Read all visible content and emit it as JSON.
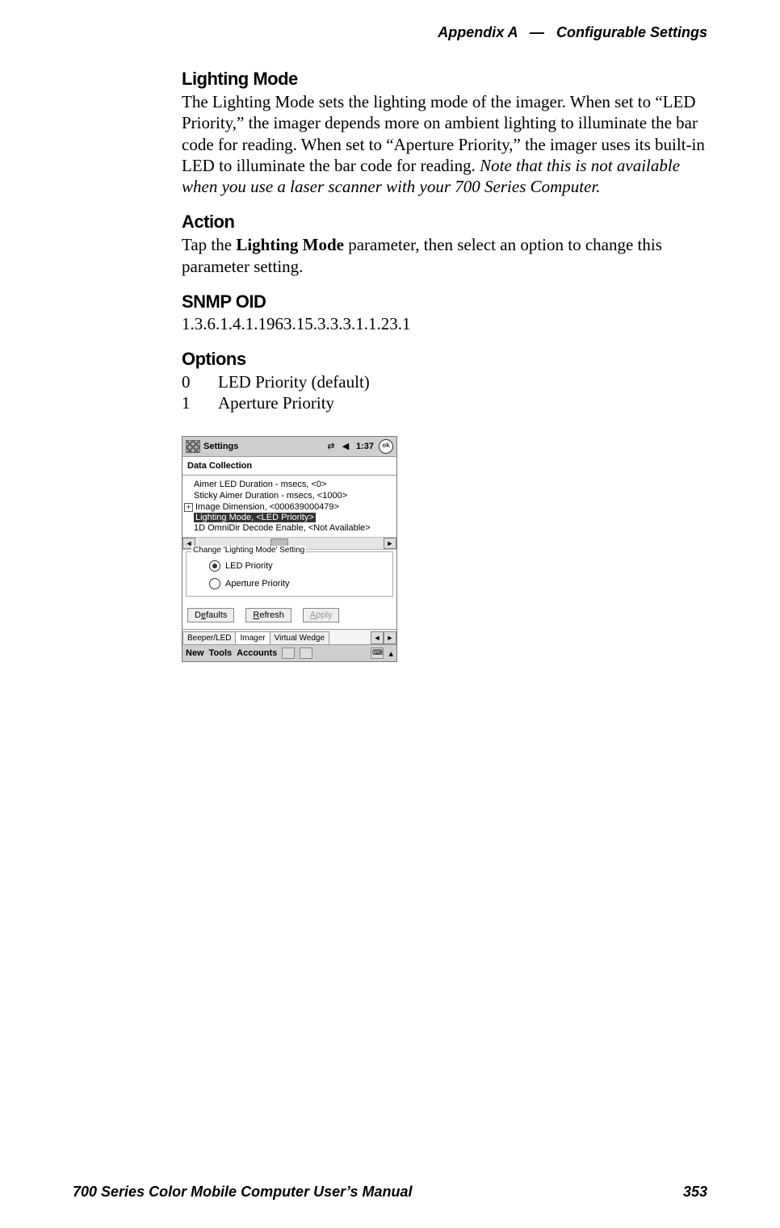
{
  "header": {
    "appendix": "Appendix A",
    "sep": "—",
    "section": "Configurable Settings"
  },
  "lighting_mode": {
    "title": "Lighting Mode",
    "body_pre": "The Lighting Mode sets the lighting mode of the imager. When set to “LED Priority,” the imager depends more on ambient lighting to illuminate the bar code for reading. When set to “Aperture Priority,” the imager uses its built-in LED to illuminate the bar code for reading. ",
    "body_italic": "Note that this is not available when you use a laser scanner with your 700 Series Computer."
  },
  "action": {
    "title": "Action",
    "pre": "Tap the ",
    "bold": "Lighting Mode",
    "post": " parameter, then select an option to change this parameter setting."
  },
  "snmp": {
    "title": "SNMP OID",
    "value": "1.3.6.1.4.1.1963.15.3.3.3.1.1.23.1"
  },
  "options": {
    "title": "Options",
    "rows": [
      {
        "key": "0",
        "label": "LED Priority (default)"
      },
      {
        "key": "1",
        "label": "Aperture Priority"
      }
    ]
  },
  "screenshot": {
    "titlebar": {
      "title": "Settings",
      "time": "1:37",
      "ok": "ok"
    },
    "app_title": "Data Collection",
    "tree": [
      "Aimer LED Duration - msecs, <0>",
      "Sticky Aimer Duration - msecs, <1000>",
      "Image Dimension, <000639000479>",
      "Lighting Mode, <LED Priority>",
      "1D OmniDir Decode Enable, <Not Available>"
    ],
    "group_title": "Change 'Lighting Mode' Setting",
    "radios": {
      "led": "LED Priority",
      "aperture": "Aperture Priority"
    },
    "buttons": {
      "defaults_pre": "D",
      "defaults_ul": "e",
      "defaults_post": "faults",
      "refresh_ul": "R",
      "refresh_post": "efresh",
      "apply_ul": "A",
      "apply_post": "pply"
    },
    "tabs": {
      "t1": "Beeper/LED",
      "t2": "Imager",
      "t3": "Virtual Wedge"
    },
    "bottom": {
      "w1": "New",
      "w2": "Tools",
      "w3": "Accounts"
    }
  },
  "footer": {
    "left": "700 Series Color Mobile Computer User’s Manual",
    "right": "353"
  }
}
